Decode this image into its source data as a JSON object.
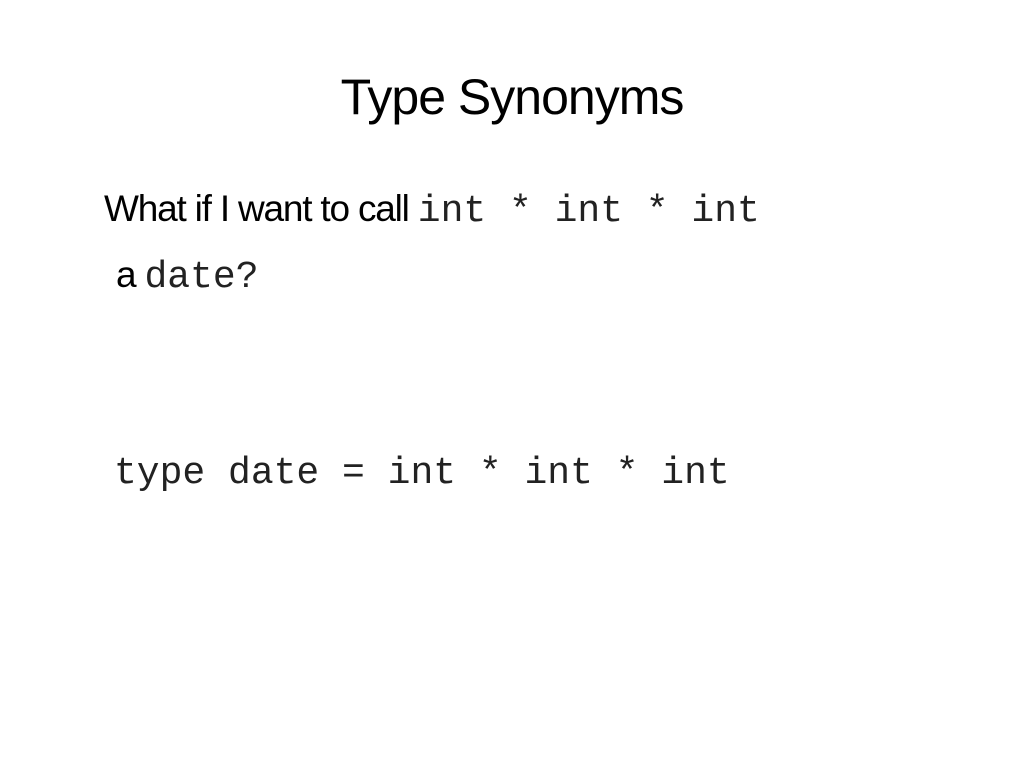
{
  "slide": {
    "title": "Type Synonyms",
    "question_prefix": "What if I want to call",
    "question_code": "int * int * int",
    "question_line2_prefix": "a",
    "question_line2_code": "date?",
    "code_example": "type date = int * int * int"
  }
}
